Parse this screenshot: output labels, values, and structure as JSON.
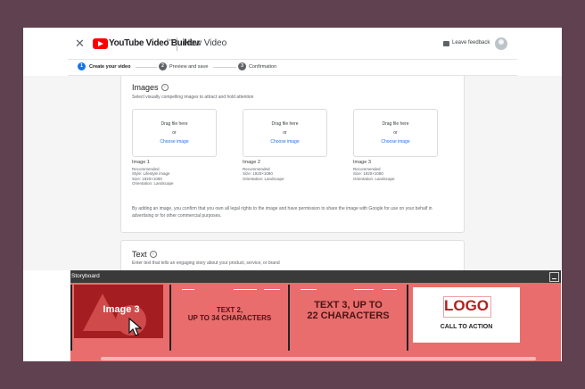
{
  "app": {
    "brand": "YouTube Video Builder",
    "beta": "Beta",
    "title": "New Video",
    "feedback": "Leave feedback"
  },
  "steps": [
    {
      "num": "1",
      "label": "Create your video",
      "active": true
    },
    {
      "num": "2",
      "label": "Preview and save",
      "active": false
    },
    {
      "num": "3",
      "label": "Confirmation",
      "active": false
    }
  ],
  "images": {
    "title": "Images",
    "subtitle": "Select visually compelling images to attract and hold attention",
    "drop": {
      "drag": "Drag file here",
      "or": "or",
      "choose": "Choose image"
    },
    "items": [
      {
        "name": "Image 1",
        "rec": "Recommended",
        "line1": "Style: Lifestyle image",
        "line2": "Size: 1920×1080",
        "line3": "Orientation: Landscape"
      },
      {
        "name": "Image 2",
        "rec": "Recommended",
        "line1": "Size: 1920×1080",
        "line2": "Orientation: Landscape",
        "line3": ""
      },
      {
        "name": "Image 3",
        "rec": "Recommended",
        "line1": "Size: 1920×1080",
        "line2": "Orientation: Landscape",
        "line3": ""
      }
    ],
    "legal": "By adding an image, you confirm that you own all legal rights to the image and have permission to share the image with Google for use on your behalf in advertising or for other commercial purposes."
  },
  "text": {
    "title": "Text",
    "subtitle": "Enter text that tells an engaging story about your product, service, or brand"
  },
  "storyboard": {
    "title": "Storyboard",
    "clips": {
      "clip1": "Image 3",
      "clip2a": "TEXT 2,",
      "clip2b": "UP TO 34 CHARACTERS",
      "clip3a": "TEXT 3, UP TO",
      "clip3b": "22 CHARACTERS",
      "logo": "LOGO",
      "cta": "CALL TO ACTION"
    }
  },
  "colors": {
    "accent": "#1a73e8",
    "storyboard": "#e96d6d",
    "frame_bg": "#5f4150"
  }
}
